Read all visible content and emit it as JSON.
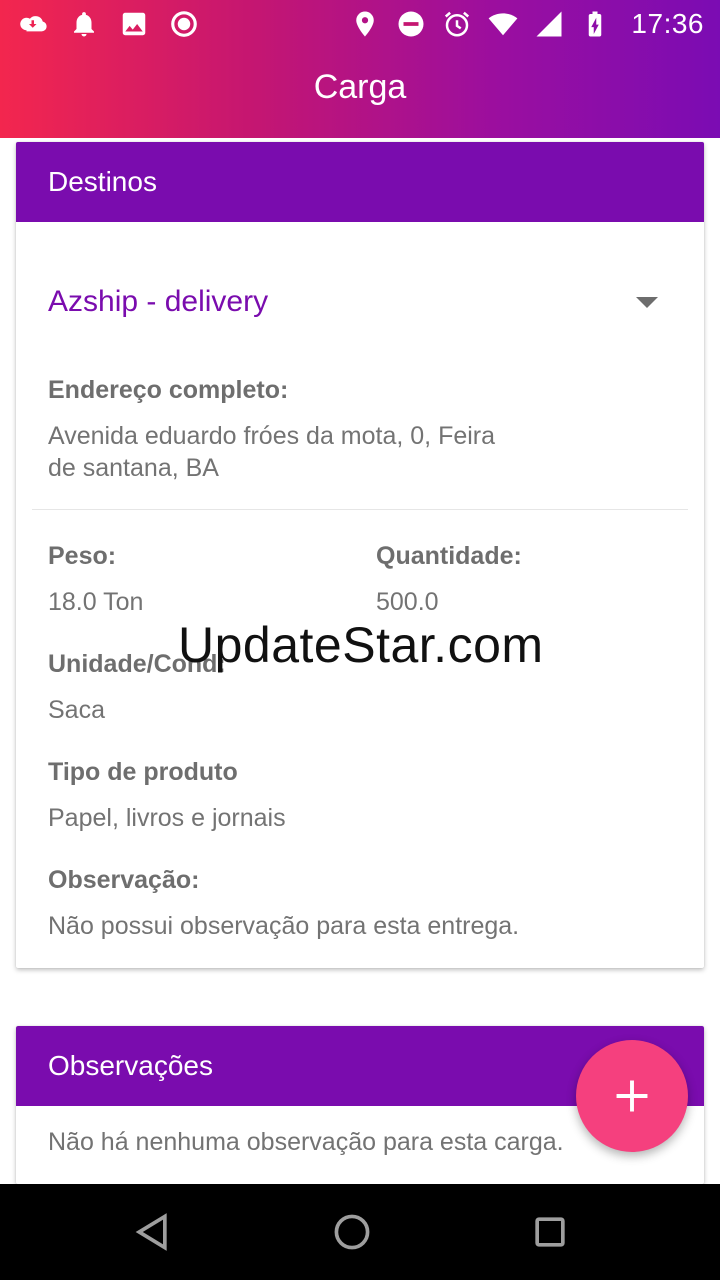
{
  "status_bar": {
    "time": "17:36",
    "left_icons": [
      "cloud-sync-icon",
      "bell-icon",
      "image-icon",
      "record-icon"
    ],
    "right_icons": [
      "location-icon",
      "do-not-disturb-icon",
      "alarm-icon",
      "wifi-icon",
      "signal-icon",
      "battery-charging-icon"
    ]
  },
  "app_bar": {
    "title": "Carga"
  },
  "destinos_card": {
    "header": "Destinos",
    "dropdown_value": "Azship - delivery",
    "address_label": "Endereço completo:",
    "address_value_line1": "Avenida eduardo fróes da mota, 0, Feira",
    "address_value_line2": "de santana, BA",
    "peso_label": "Peso:",
    "peso_value": "18.0 Ton",
    "quantidade_label": "Quantidade:",
    "quantidade_value": "500.0",
    "unidade_label": "Unidade/Cond:",
    "unidade_value": "Saca",
    "tipo_label": "Tipo de produto",
    "tipo_value": "Papel, livros e jornais",
    "observacao_label": "Observação:",
    "observacao_value": "Não possui observação para esta entrega."
  },
  "observacoes_card": {
    "header": "Observações",
    "text": "Não há nenhuma observação para esta carga."
  },
  "watermark": "UpdateStar.com",
  "colors": {
    "accent": "#7a0cae",
    "fab": "#f5407e",
    "gradient_start": "#f3264e",
    "gradient_end": "#7b0cb3"
  }
}
